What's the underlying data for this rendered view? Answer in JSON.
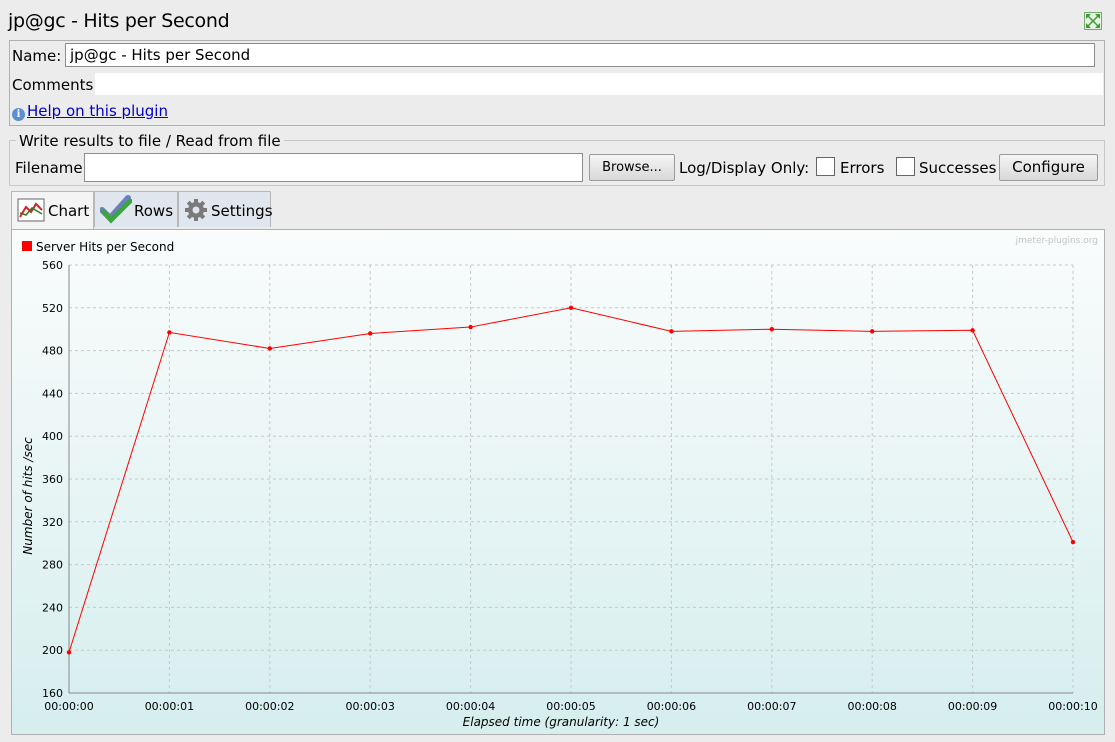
{
  "window": {
    "title": "jp@gc - Hits per Second"
  },
  "form": {
    "name_label": "Name:",
    "name_value": "jp@gc - Hits per Second",
    "comments_label": "Comments:",
    "help_link": "Help on this plugin"
  },
  "file_panel": {
    "legend": "Write results to file / Read from file",
    "filename_label": "Filename",
    "filename_value": "",
    "browse_label": "Browse...",
    "log_display_label": "Log/Display Only:",
    "errors_label": "Errors",
    "successes_label": "Successes",
    "configure_label": "Configure"
  },
  "tabs": [
    {
      "label": "Chart",
      "icon": "chart-icon",
      "active": true
    },
    {
      "label": "Rows",
      "icon": "checkmark-icon",
      "active": false
    },
    {
      "label": "Settings",
      "icon": "gear-icon",
      "active": false
    }
  ],
  "colors": {
    "series": "#ff0000",
    "grid": "#c8c8c8"
  },
  "chart_data": {
    "type": "line",
    "watermark": "jmeter-plugins.org",
    "xlabel": "Elapsed time (granularity: 1 sec)",
    "ylabel": "Number of hits /sec",
    "ylim": [
      160,
      560
    ],
    "yticks": [
      160,
      200,
      240,
      280,
      320,
      360,
      400,
      440,
      480,
      520,
      560
    ],
    "x": [
      "00:00:00",
      "00:00:01",
      "00:00:02",
      "00:00:03",
      "00:00:04",
      "00:00:05",
      "00:00:06",
      "00:00:07",
      "00:00:08",
      "00:00:09",
      "00:00:10"
    ],
    "series": [
      {
        "name": "Server Hits per Second",
        "values": [
          198,
          497,
          482,
          496,
          502,
          520,
          498,
          500,
          498,
          499,
          301
        ]
      }
    ],
    "legend": "top-left",
    "grid": true
  }
}
